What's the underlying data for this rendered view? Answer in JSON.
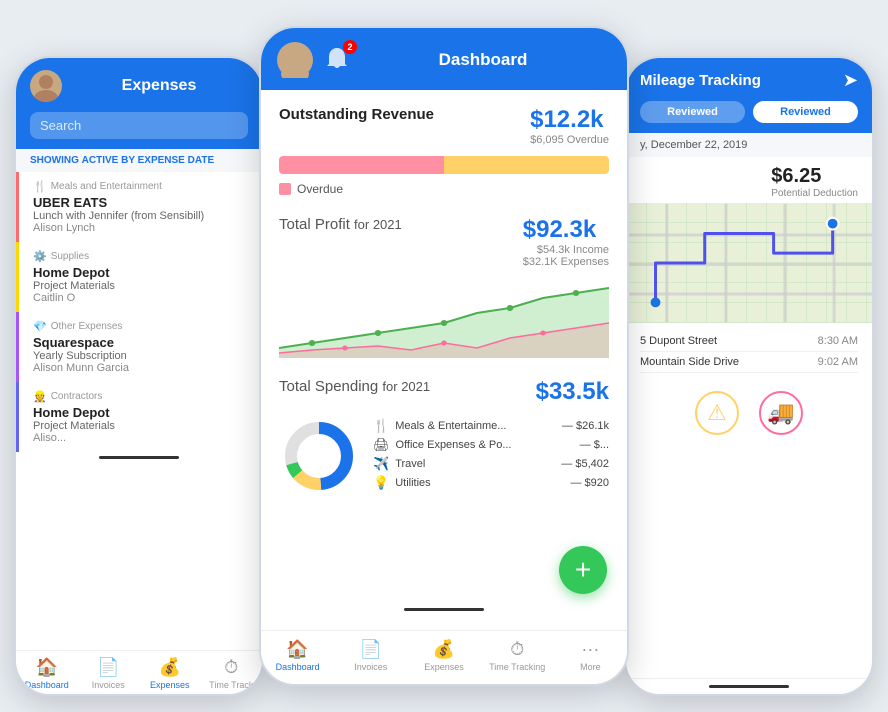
{
  "left_phone": {
    "title": "Expenses",
    "search_placeholder": "Search",
    "filter_label": "SHOWING",
    "filter_highlight": "ACTIVE BY EXPENSE DATE",
    "categories": [
      {
        "icon": "🍴",
        "label": "Meals and Entertainment",
        "color": "meals",
        "items": [
          {
            "title": "UBER EATS",
            "sub1": "Lunch with Jennifer (from Sensibill)",
            "sub2": "Alison Lynch"
          }
        ]
      },
      {
        "icon": "⚙️",
        "label": "Supplies",
        "color": "supplies",
        "items": [
          {
            "title": "Home Depot",
            "sub1": "Project Materials",
            "sub2": "Caitlin O"
          }
        ]
      },
      {
        "icon": "💎",
        "label": "Other Expenses",
        "color": "other",
        "items": [
          {
            "title": "Squarespace",
            "sub1": "Yearly Subscription",
            "sub2": "Alison Munn Garcia"
          }
        ]
      },
      {
        "icon": "👷",
        "label": "Contractors",
        "color": "contractors",
        "items": [
          {
            "title": "Home Depot",
            "sub1": "Project Materials",
            "sub2": "Aliso..."
          }
        ]
      }
    ],
    "nav_items": [
      {
        "icon": "🏠",
        "label": "Dashboard"
      },
      {
        "icon": "📄",
        "label": "Invoices"
      },
      {
        "icon": "💰",
        "label": "Expenses",
        "active": true
      },
      {
        "icon": "⏱",
        "label": "Time Track"
      }
    ]
  },
  "center_phone": {
    "header_title": "Dashboard",
    "notif_count": "2",
    "sections": {
      "revenue": {
        "title": "Outstanding Revenue",
        "amount": "$12.2k",
        "sub": "$6,095 Overdue",
        "overdue_label": "Overdue"
      },
      "profit": {
        "title": "Total Profit",
        "title_suffix": "for 2021",
        "amount": "$92.3k",
        "income": "$54.3k Income",
        "expenses": "$32.1K Expenses"
      },
      "spending": {
        "title": "Total Spending",
        "title_suffix": "for 2021",
        "amount": "$33.5k",
        "items": [
          {
            "icon": "🍴",
            "label": "Meals & Entertainme...",
            "value": "— $26.1k"
          },
          {
            "icon": "🖨",
            "label": "Office Expenses & Po...",
            "value": "— $..."
          },
          {
            "icon": "✈️",
            "label": "Travel",
            "value": "— $5,402"
          },
          {
            "icon": "💡",
            "label": "Utilities",
            "value": "— $920"
          }
        ]
      }
    },
    "nav_items": [
      {
        "icon": "🏠",
        "label": "Dashboard",
        "active": true
      },
      {
        "icon": "📄",
        "label": "Invoices"
      },
      {
        "icon": "💰",
        "label": "Expenses"
      },
      {
        "icon": "⏱",
        "label": "Time Tracking"
      },
      {
        "icon": "···",
        "label": "More"
      }
    ],
    "fab_label": "+"
  },
  "right_phone": {
    "header_title": "Mileage Tracking",
    "tabs": [
      {
        "label": "Reviewed",
        "active": false
      },
      {
        "label": "Reviewed",
        "active": true
      }
    ],
    "date": "y, December 22, 2019",
    "amount": "$6.25",
    "deduction": "Potential Deduction",
    "trips": [
      {
        "address": "5 Dupont Street",
        "time": "8:30 AM"
      },
      {
        "address": "Mountain Side Drive",
        "time": "9:02 AM"
      }
    ],
    "action_icons": [
      {
        "icon": "⚠️",
        "color": "#ffd166"
      },
      {
        "icon": "🚚",
        "color": "#ff6b9d"
      }
    ]
  }
}
